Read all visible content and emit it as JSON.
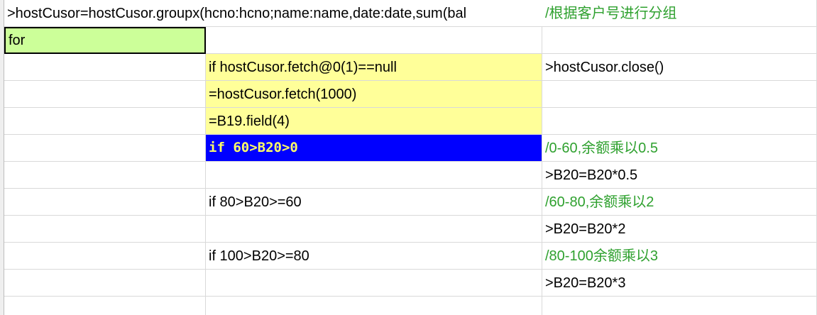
{
  "rows": [
    {
      "expr": ">hostCusor=hostCusor.groupx(hcno:hcno;name:name,date:date,sum(bal",
      "comment": "/根据客户号进行分组"
    },
    {
      "label": "for"
    },
    {
      "condition": "if hostCusor.fetch@0(1)==null",
      "action": ">hostCusor.close()"
    },
    {
      "assign": "=hostCusor.fetch(1000)"
    },
    {
      "assign": "=B19.field(4)"
    },
    {
      "condition": "if 60>B20>0",
      "comment": "/0-60,余额乘以0.5"
    },
    {
      "action": ">B20=B20*0.5"
    },
    {
      "condition": "if  80>B20>=60",
      "comment": "/60-80,余额乘以2"
    },
    {
      "action": ">B20=B20*2"
    },
    {
      "condition": "if 100>B20>=80",
      "comment": "/80-100余额乘以3"
    },
    {
      "action": ">B20=B20*3"
    },
    {}
  ],
  "colors": {
    "yellow_cell": "#ffff99",
    "green_cell": "#ccff99",
    "selected_cell": "#0000ff",
    "selected_text": "#ffff66",
    "comment_text": "#2fa12f",
    "grid_line": "#d9d9d9"
  }
}
